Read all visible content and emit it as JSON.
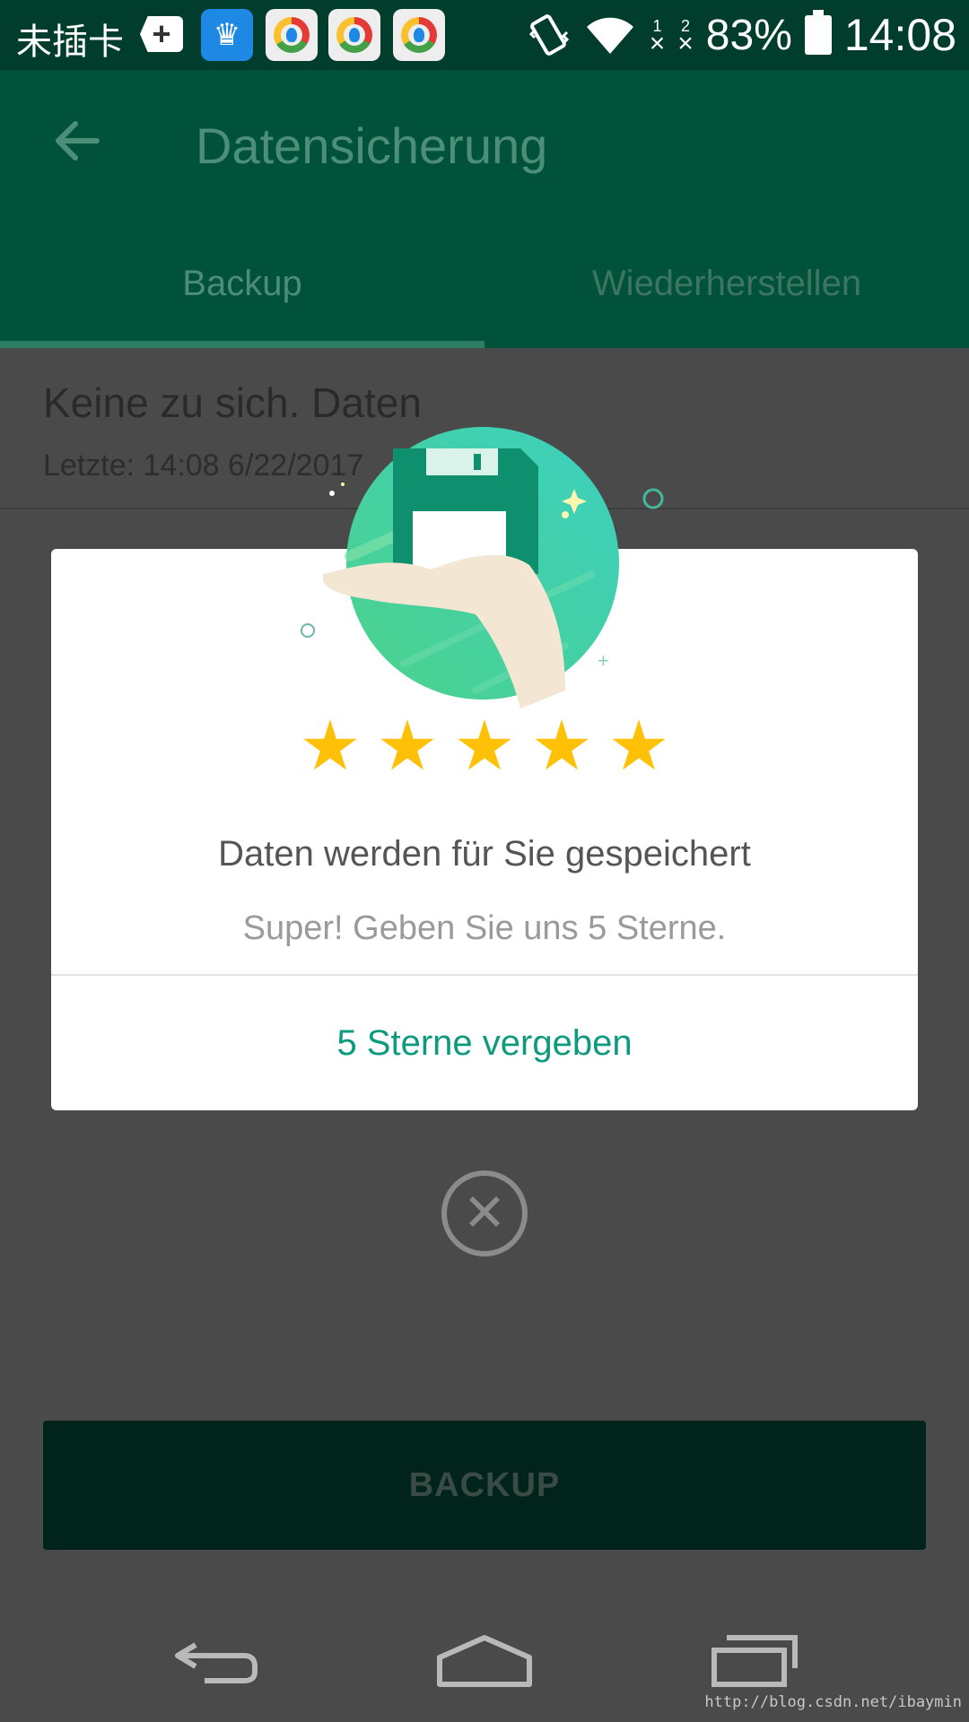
{
  "status_bar": {
    "carrier": "未插卡",
    "sim1": "1",
    "sim2": "2",
    "battery_pct": "83%",
    "time": "14:08"
  },
  "app_bar": {
    "title": "Datensicherung",
    "tabs": [
      {
        "label": "Backup"
      },
      {
        "label": "Wiederherstellen"
      }
    ]
  },
  "content": {
    "title": "Keine zu sich. Daten",
    "last_label": "Letzte: 14:08 6/22/2017"
  },
  "dialog": {
    "title": "Daten werden für Sie gespeichert",
    "subtitle": "Super! Geben Sie uns 5 Sterne.",
    "rating": 5,
    "action_label": "5 Sterne vergeben"
  },
  "backup_button": {
    "label": "BACKUP"
  },
  "watermark": "http://blog.csdn.net/ibaymin",
  "colors": {
    "app_bar": "#00523b",
    "status_bar": "#003d2c",
    "accent": "#0e9a7f",
    "star": "#ffc107"
  }
}
